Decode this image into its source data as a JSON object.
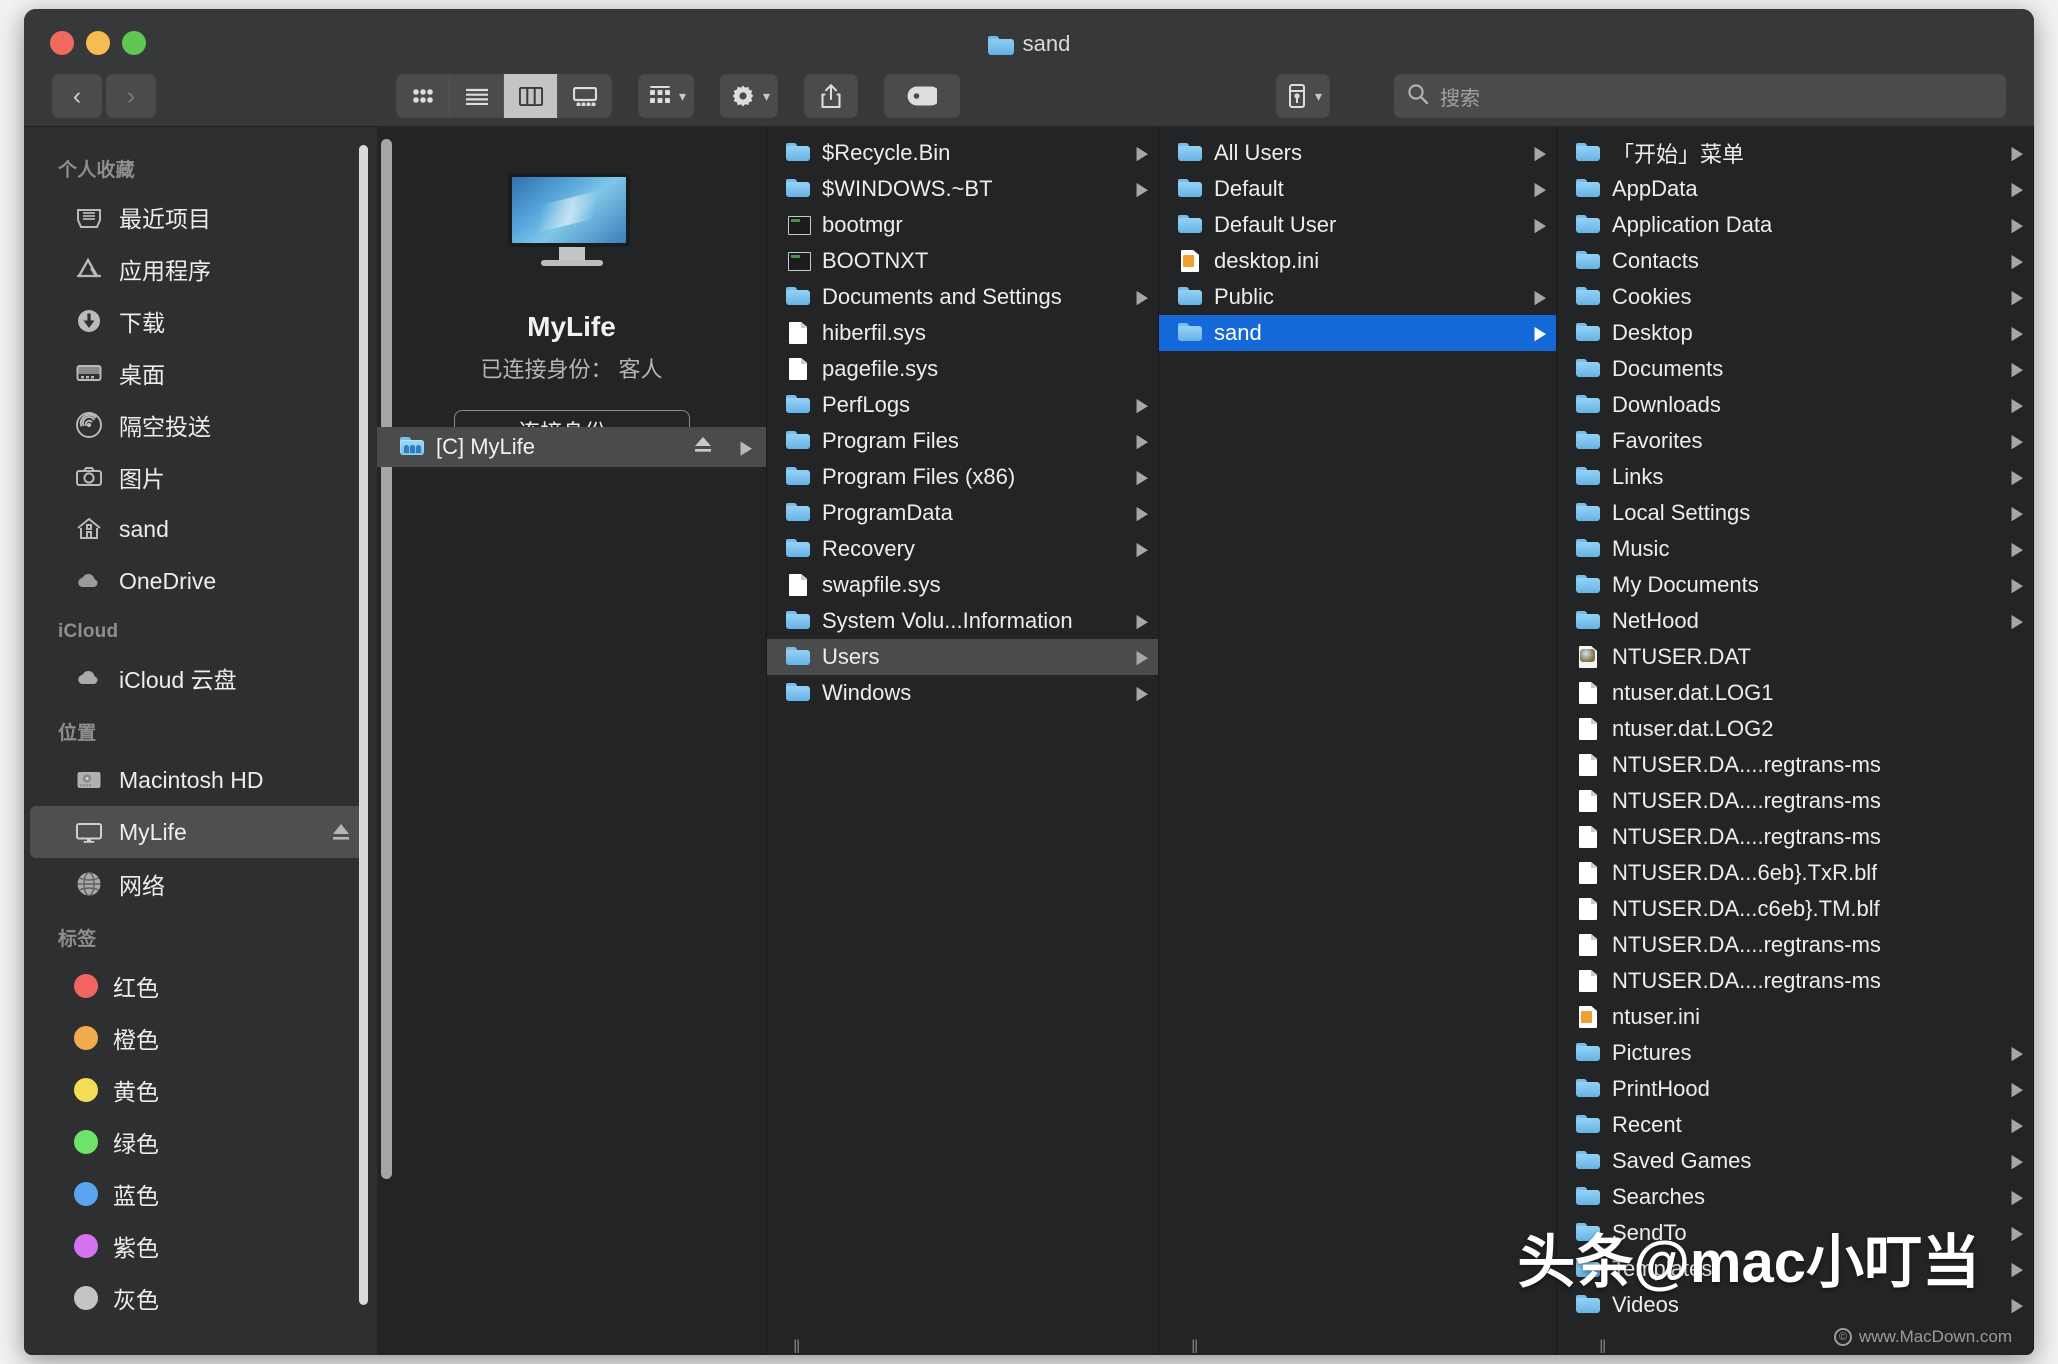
{
  "window": {
    "title": "sand",
    "title_icon": "folder-icon",
    "traffic_lights": [
      "close-red",
      "minimize-yellow",
      "zoom-green"
    ]
  },
  "toolbar": {
    "back_label": "‹",
    "forward_label": "›",
    "view_modes": [
      {
        "name": "icon-view",
        "active": false
      },
      {
        "name": "list-view",
        "active": false
      },
      {
        "name": "column-view",
        "active": true
      },
      {
        "name": "gallery-view",
        "active": false
      }
    ],
    "group_by_label": "group-icon",
    "action_label": "gear-icon",
    "share_label": "share-icon",
    "tags_label": "tag-icon",
    "dropbox_label": "dropbox-icon",
    "search_placeholder": "搜索"
  },
  "sidebar": {
    "sections": [
      {
        "title": "个人收藏",
        "items": [
          {
            "label": "最近项目",
            "icon": "recents-icon",
            "selected": false,
            "eject": false
          },
          {
            "label": "应用程序",
            "icon": "applications-icon",
            "selected": false,
            "eject": false
          },
          {
            "label": "下载",
            "icon": "downloads-icon",
            "selected": false,
            "eject": false
          },
          {
            "label": "桌面",
            "icon": "desktop-icon",
            "selected": false,
            "eject": false
          },
          {
            "label": "隔空投送",
            "icon": "airdrop-icon",
            "selected": false,
            "eject": false
          },
          {
            "label": "图片",
            "icon": "pictures-icon",
            "selected": false,
            "eject": false
          },
          {
            "label": "sand",
            "icon": "home-icon",
            "selected": false,
            "eject": false
          },
          {
            "label": "OneDrive",
            "icon": "cloud-icon",
            "selected": false,
            "eject": false
          }
        ]
      },
      {
        "title": "iCloud",
        "items": [
          {
            "label": "iCloud 云盘",
            "icon": "icloud-icon",
            "selected": false,
            "eject": false
          }
        ]
      },
      {
        "title": "位置",
        "items": [
          {
            "label": "Macintosh HD",
            "icon": "harddisk-icon",
            "selected": false,
            "eject": false
          },
          {
            "label": "MyLife",
            "icon": "display-icon",
            "selected": true,
            "eject": true
          },
          {
            "label": "网络",
            "icon": "network-icon",
            "selected": false,
            "eject": false
          }
        ]
      },
      {
        "title": "标签",
        "tags": [
          {
            "label": "红色",
            "color": "#f0655f"
          },
          {
            "label": "橙色",
            "color": "#f0ad4e"
          },
          {
            "label": "黄色",
            "color": "#f5dc56"
          },
          {
            "label": "绿色",
            "color": "#6ee36a"
          },
          {
            "label": "蓝色",
            "color": "#5ba4f0"
          },
          {
            "label": "紫色",
            "color": "#d472ef"
          },
          {
            "label": "灰色",
            "color": "#c3c4c6"
          }
        ]
      }
    ]
  },
  "preview": {
    "device_icon": "imac-display-icon",
    "name": "MyLife",
    "status": "已连接身份： 客人",
    "connect_button": "连接身份...",
    "volume": {
      "label": "[C] MyLife",
      "icon": "shared-folder-icon",
      "selected": true
    }
  },
  "columns": [
    {
      "name": "drive-root",
      "items": [
        {
          "label": "$Recycle.Bin",
          "icon": "folder-icon",
          "arrow": true,
          "state": "none"
        },
        {
          "label": "$WINDOWS.~BT",
          "icon": "folder-icon",
          "arrow": true,
          "state": "none"
        },
        {
          "label": "bootmgr",
          "icon": "system-file-icon",
          "arrow": false,
          "state": "none"
        },
        {
          "label": "BOOTNXT",
          "icon": "system-file-icon",
          "arrow": false,
          "state": "none"
        },
        {
          "label": "Documents and Settings",
          "icon": "folder-icon",
          "arrow": true,
          "state": "none"
        },
        {
          "label": "hiberfil.sys",
          "icon": "document-icon",
          "arrow": false,
          "state": "none"
        },
        {
          "label": "pagefile.sys",
          "icon": "document-icon",
          "arrow": false,
          "state": "none"
        },
        {
          "label": "PerfLogs",
          "icon": "folder-icon",
          "arrow": true,
          "state": "none"
        },
        {
          "label": "Program Files",
          "icon": "folder-icon",
          "arrow": true,
          "state": "none"
        },
        {
          "label": "Program Files (x86)",
          "icon": "folder-icon",
          "arrow": true,
          "state": "none"
        },
        {
          "label": "ProgramData",
          "icon": "folder-icon",
          "arrow": true,
          "state": "none"
        },
        {
          "label": "Recovery",
          "icon": "folder-icon",
          "arrow": true,
          "state": "none"
        },
        {
          "label": "swapfile.sys",
          "icon": "document-icon",
          "arrow": false,
          "state": "none"
        },
        {
          "label": "System Volu...Information",
          "icon": "folder-icon",
          "arrow": true,
          "state": "none"
        },
        {
          "label": "Users",
          "icon": "folder-icon",
          "arrow": true,
          "state": "gray"
        },
        {
          "label": "Windows",
          "icon": "folder-icon",
          "arrow": true,
          "state": "none"
        }
      ]
    },
    {
      "name": "users-folder",
      "items": [
        {
          "label": "All Users",
          "icon": "folder-icon",
          "arrow": true,
          "state": "none"
        },
        {
          "label": "Default",
          "icon": "folder-icon",
          "arrow": true,
          "state": "none"
        },
        {
          "label": "Default User",
          "icon": "folder-icon",
          "arrow": true,
          "state": "none"
        },
        {
          "label": "desktop.ini",
          "icon": "ini-file-icon",
          "arrow": false,
          "state": "none"
        },
        {
          "label": "Public",
          "icon": "folder-icon",
          "arrow": true,
          "state": "none"
        },
        {
          "label": "sand",
          "icon": "folder-icon",
          "arrow": true,
          "state": "blue"
        }
      ]
    },
    {
      "name": "sand-folder",
      "items": [
        {
          "label": "「开始」菜单",
          "icon": "folder-icon",
          "arrow": true,
          "state": "none"
        },
        {
          "label": "AppData",
          "icon": "folder-icon",
          "arrow": true,
          "state": "none"
        },
        {
          "label": "Application Data",
          "icon": "folder-icon",
          "arrow": true,
          "state": "none"
        },
        {
          "label": "Contacts",
          "icon": "folder-icon",
          "arrow": true,
          "state": "none"
        },
        {
          "label": "Cookies",
          "icon": "folder-icon",
          "arrow": true,
          "state": "none"
        },
        {
          "label": "Desktop",
          "icon": "folder-icon",
          "arrow": true,
          "state": "none"
        },
        {
          "label": "Documents",
          "icon": "folder-icon",
          "arrow": true,
          "state": "none"
        },
        {
          "label": "Downloads",
          "icon": "folder-icon",
          "arrow": true,
          "state": "none"
        },
        {
          "label": "Favorites",
          "icon": "folder-icon",
          "arrow": true,
          "state": "none"
        },
        {
          "label": "Links",
          "icon": "folder-icon",
          "arrow": true,
          "state": "none"
        },
        {
          "label": "Local Settings",
          "icon": "folder-icon",
          "arrow": true,
          "state": "none"
        },
        {
          "label": "Music",
          "icon": "folder-icon",
          "arrow": true,
          "state": "none"
        },
        {
          "label": "My Documents",
          "icon": "folder-icon",
          "arrow": true,
          "state": "none"
        },
        {
          "label": "NetHood",
          "icon": "folder-icon",
          "arrow": true,
          "state": "none"
        },
        {
          "label": "NTUSER.DAT",
          "icon": "dat-file-icon",
          "arrow": false,
          "state": "none"
        },
        {
          "label": "ntuser.dat.LOG1",
          "icon": "document-icon",
          "arrow": false,
          "state": "none"
        },
        {
          "label": "ntuser.dat.LOG2",
          "icon": "document-icon",
          "arrow": false,
          "state": "none"
        },
        {
          "label": "NTUSER.DA....regtrans-ms",
          "icon": "document-icon",
          "arrow": false,
          "state": "none"
        },
        {
          "label": "NTUSER.DA....regtrans-ms",
          "icon": "document-icon",
          "arrow": false,
          "state": "none"
        },
        {
          "label": "NTUSER.DA....regtrans-ms",
          "icon": "document-icon",
          "arrow": false,
          "state": "none"
        },
        {
          "label": "NTUSER.DA...6eb}.TxR.blf",
          "icon": "document-icon",
          "arrow": false,
          "state": "none"
        },
        {
          "label": "NTUSER.DA...c6eb}.TM.blf",
          "icon": "document-icon",
          "arrow": false,
          "state": "none"
        },
        {
          "label": "NTUSER.DA....regtrans-ms",
          "icon": "document-icon",
          "arrow": false,
          "state": "none"
        },
        {
          "label": "NTUSER.DA....regtrans-ms",
          "icon": "document-icon",
          "arrow": false,
          "state": "none"
        },
        {
          "label": "ntuser.ini",
          "icon": "ini-file-icon",
          "arrow": false,
          "state": "none"
        },
        {
          "label": "Pictures",
          "icon": "folder-icon",
          "arrow": true,
          "state": "none"
        },
        {
          "label": "PrintHood",
          "icon": "folder-icon",
          "arrow": true,
          "state": "none"
        },
        {
          "label": "Recent",
          "icon": "folder-icon",
          "arrow": true,
          "state": "none"
        },
        {
          "label": "Saved Games",
          "icon": "folder-icon",
          "arrow": true,
          "state": "none"
        },
        {
          "label": "Searches",
          "icon": "folder-icon",
          "arrow": true,
          "state": "none"
        },
        {
          "label": "SendTo",
          "icon": "folder-icon",
          "arrow": true,
          "state": "none"
        },
        {
          "label": "Templates",
          "icon": "folder-icon",
          "arrow": true,
          "state": "none"
        },
        {
          "label": "Videos",
          "icon": "folder-icon",
          "arrow": true,
          "state": "none"
        }
      ]
    }
  ],
  "watermark": {
    "main": "头条@mac小叮当",
    "sub": "www.MacDown.com"
  }
}
